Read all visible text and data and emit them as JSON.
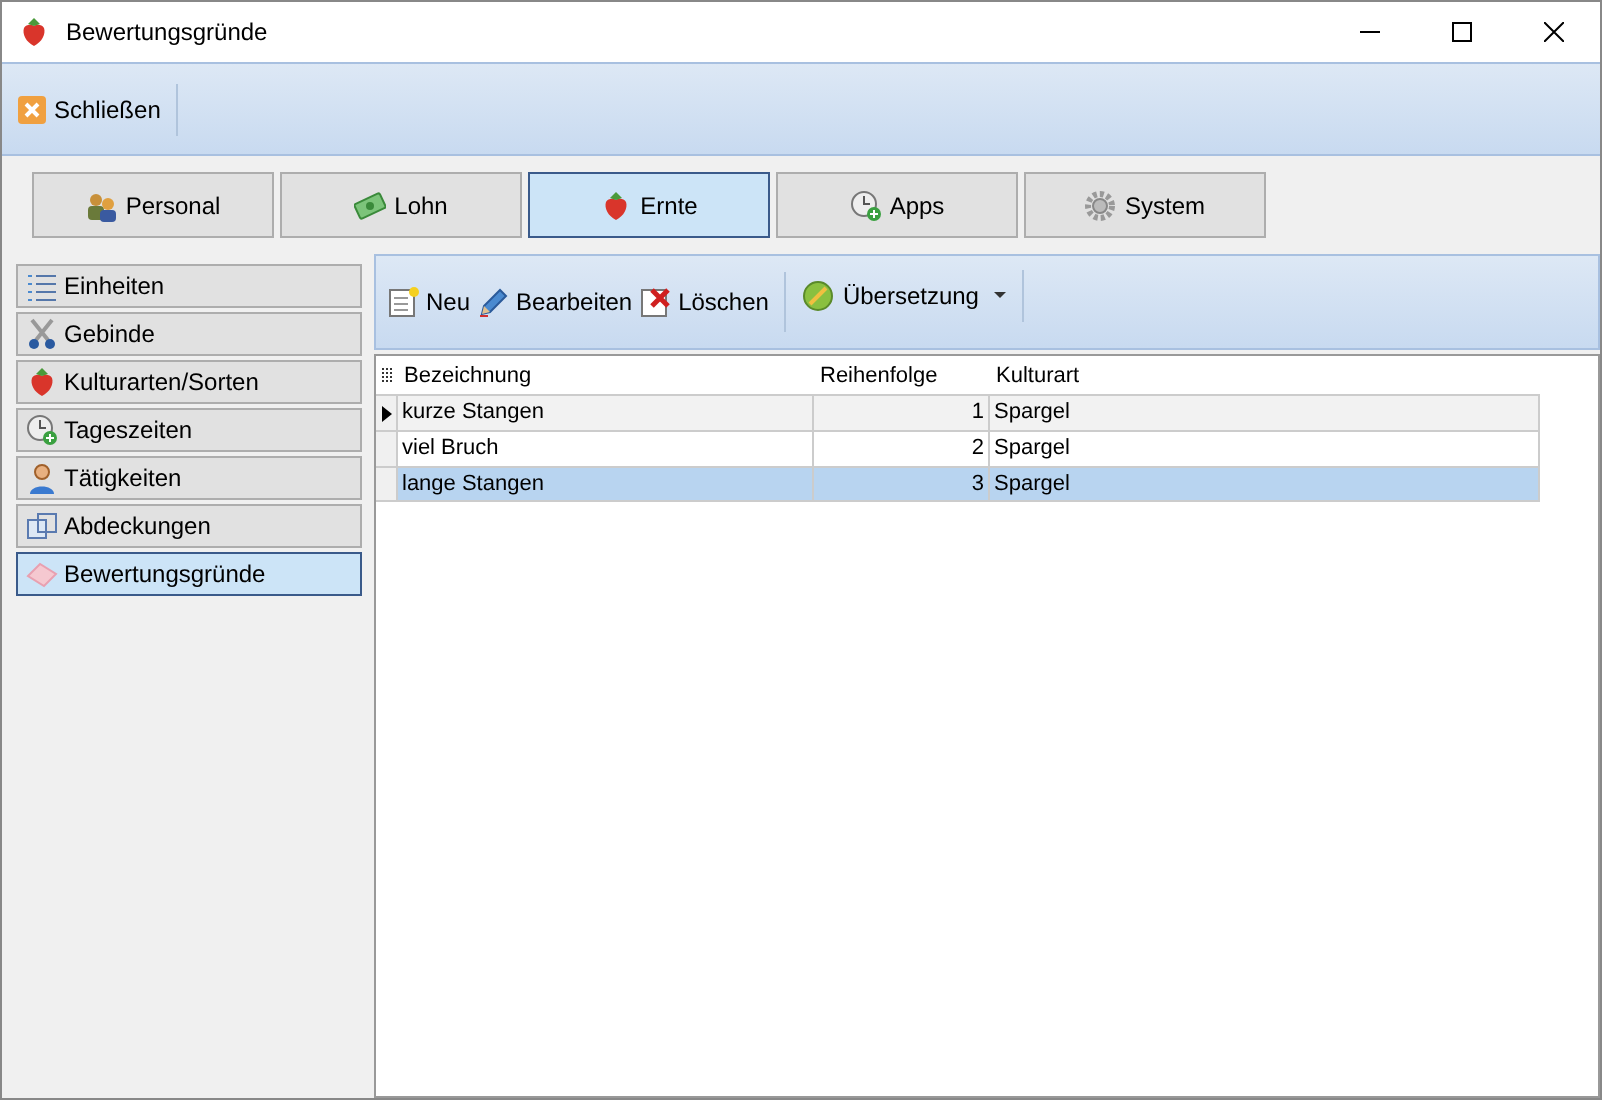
{
  "window": {
    "title": "Bewertungsgründe"
  },
  "toolbar": {
    "close_label": "Schließen"
  },
  "modules": [
    {
      "label": "Personal",
      "selected": false
    },
    {
      "label": "Lohn",
      "selected": false
    },
    {
      "label": "Ernte",
      "selected": true
    },
    {
      "label": "Apps",
      "selected": false
    },
    {
      "label": "System",
      "selected": false
    }
  ],
  "sidebar": {
    "items": [
      {
        "label": "Einheiten",
        "selected": false
      },
      {
        "label": "Gebinde",
        "selected": false
      },
      {
        "label": "Kulturarten/Sorten",
        "selected": false
      },
      {
        "label": "Tageszeiten",
        "selected": false
      },
      {
        "label": "Tätigkeiten",
        "selected": false
      },
      {
        "label": "Abdeckungen",
        "selected": false
      },
      {
        "label": "Bewertungsgründe",
        "selected": true
      }
    ]
  },
  "actions": [
    {
      "label": "Neu"
    },
    {
      "label": "Bearbeiten"
    },
    {
      "label": "Löschen"
    }
  ],
  "translation": {
    "label": "Übersetzung"
  },
  "table": {
    "columns": [
      "Bezeichnung",
      "Reihenfolge",
      "Kulturart"
    ],
    "rows": [
      {
        "cells": [
          "kurze Stangen",
          "1",
          "Spargel"
        ],
        "current": true,
        "selected": false
      },
      {
        "cells": [
          "viel Bruch",
          "2",
          "Spargel"
        ],
        "current": false,
        "selected": false
      },
      {
        "cells": [
          "lange Stangen",
          "3",
          "Spargel"
        ],
        "current": false,
        "selected": true
      }
    ]
  }
}
